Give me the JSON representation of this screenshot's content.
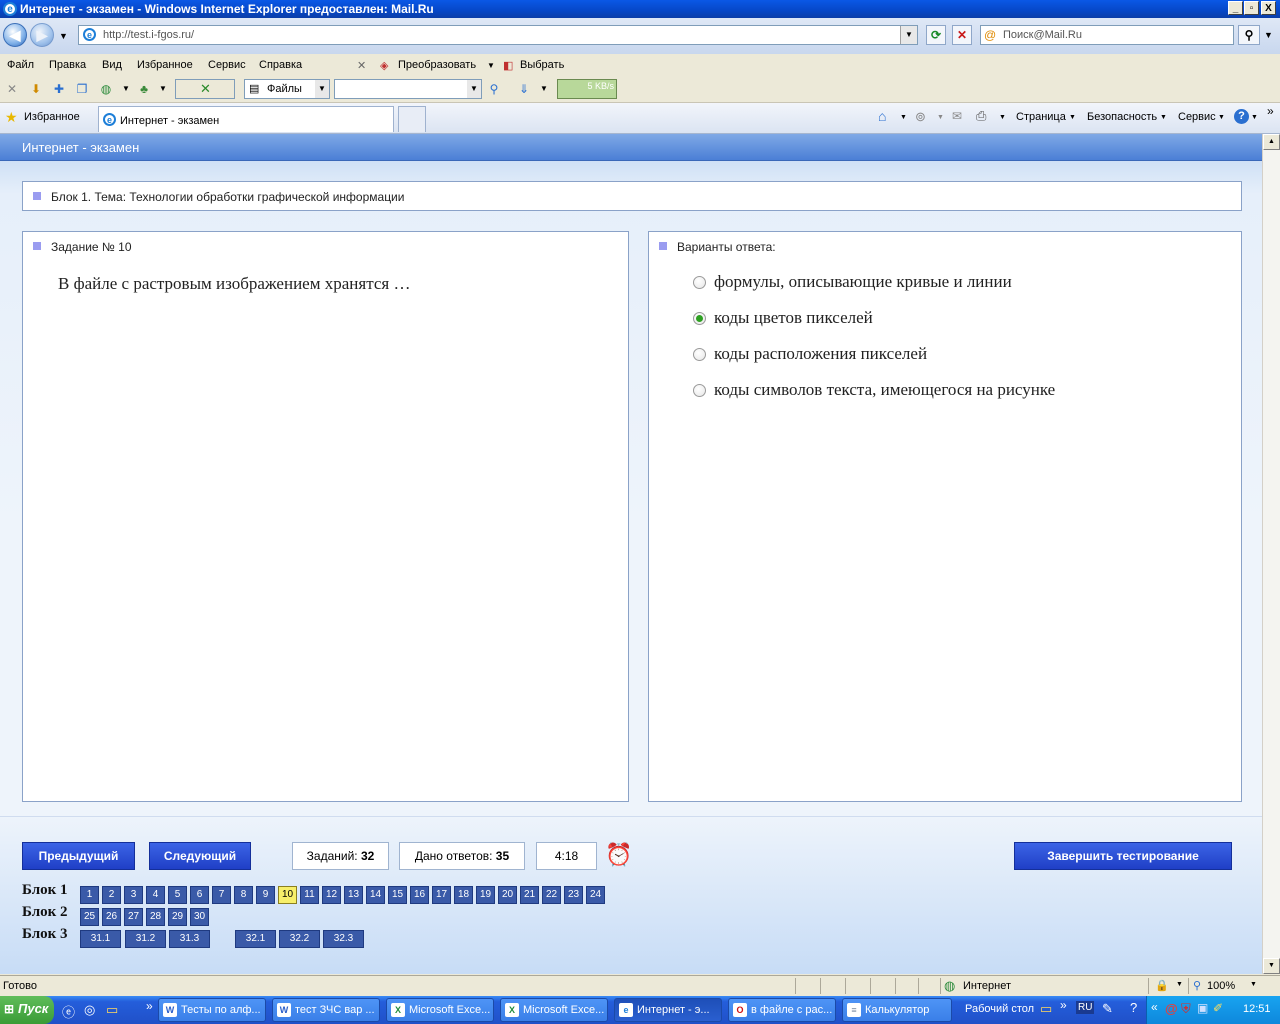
{
  "window": {
    "title": "Интернет - экзамен - Windows Internet Explorer предоставлен: Mail.Ru",
    "buttons": [
      "_",
      "▫",
      "X"
    ]
  },
  "address_bar": {
    "url": "http://test.i-fgos.ru/",
    "search_placeholder": "Поиск@Mail.Ru"
  },
  "menu": {
    "items": [
      "Файл",
      "Правка",
      "Вид",
      "Избранное",
      "Сервис",
      "Справка"
    ],
    "convert_label": "Преобразовать",
    "select_label": "Выбрать"
  },
  "toolbar": {
    "files_label": "Файлы",
    "speed": "5 KB/s"
  },
  "tabs": {
    "favorites_label": "Избранное",
    "active_tab": "Интернет - экзамен",
    "commands": [
      "Страница",
      "Безопасность",
      "Сервис"
    ]
  },
  "page": {
    "header_title": "Интернет - экзамен",
    "block_title": "Блок 1. Тема: Технологии обработки графической информации",
    "task_title": "Задание № 10",
    "question": "В файле с растровым изображением хранятся …",
    "answers_title": "Варианты ответа:",
    "options": [
      {
        "label": "формулы, описывающие кривые и линии",
        "selected": false
      },
      {
        "label": "коды цветов пикселей",
        "selected": true
      },
      {
        "label": "коды расположения пикселей",
        "selected": false
      },
      {
        "label": "коды символов текста, имеющегося на рисунке",
        "selected": false
      }
    ],
    "buttons": {
      "prev": "Предыдущий",
      "next": "Следующий",
      "finish": "Завершить тестирование"
    },
    "stats": {
      "tasks_label": "Заданий:",
      "tasks_value": "32",
      "answered_label": "Дано ответов:",
      "answered_value": "35",
      "timer": "4:18"
    },
    "blocks": [
      {
        "label": "Блок 1",
        "items": [
          "1",
          "2",
          "3",
          "4",
          "5",
          "6",
          "7",
          "8",
          "9",
          "10",
          "11",
          "12",
          "13",
          "14",
          "15",
          "16",
          "17",
          "18",
          "19",
          "20",
          "21",
          "22",
          "23",
          "24"
        ],
        "current": "10"
      },
      {
        "label": "Блок 2",
        "items": [
          "25",
          "26",
          "27",
          "28",
          "29",
          "30"
        ]
      },
      {
        "label": "Блок 3",
        "items": [
          "31.1",
          "31.2",
          "31.3",
          "32.1",
          "32.2",
          "32.3"
        ]
      }
    ]
  },
  "status_bar": {
    "left": "Готово",
    "zone": "Интернет",
    "zoom": "100%"
  },
  "taskbar": {
    "start": "Пуск",
    "tasks": [
      {
        "label": "Тесты по алф...",
        "icon": "W",
        "color": "#2b5fc9"
      },
      {
        "label": "тест ЗЧС вар ...",
        "icon": "W",
        "color": "#2b5fc9"
      },
      {
        "label": "Microsoft Exce...",
        "icon": "X",
        "color": "#1f8b3a"
      },
      {
        "label": "Microsoft Exce...",
        "icon": "X",
        "color": "#1f8b3a"
      },
      {
        "label": "Интернет - э...",
        "icon": "e",
        "color": "#1e7fd8"
      },
      {
        "label": "в файле с рас...",
        "icon": "O",
        "color": "#d01010"
      },
      {
        "label": "Калькулятор",
        "icon": "≡",
        "color": "#7a8aa0"
      }
    ],
    "desktop_label": "Рабочий стол",
    "lang": "RU",
    "clock": "12:51"
  }
}
